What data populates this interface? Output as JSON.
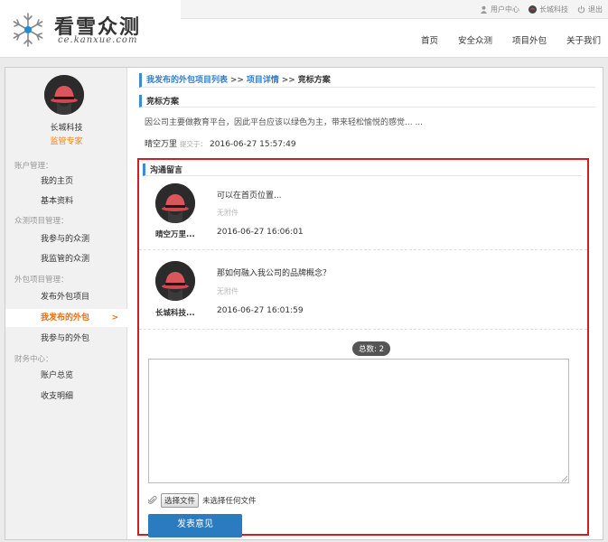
{
  "header": {
    "logo_title": "看雪众测",
    "logo_subtitle": "ce.kanxue.com",
    "top_links": [
      "用户中心",
      "长城科技",
      "退出"
    ],
    "nav": [
      "首页",
      "安全众测",
      "项目外包",
      "关于我们"
    ]
  },
  "sidebar": {
    "username": "长城科技",
    "role": "监管专家",
    "groups": [
      {
        "title": "账户管理：",
        "items": [
          "我的主页",
          "基本资料"
        ]
      },
      {
        "title": "众测项目管理：",
        "items": [
          "我参与的众测",
          "我监管的众测"
        ]
      },
      {
        "title": "外包项目管理：",
        "items": [
          "发布外包项目",
          "我发布的外包",
          "我参与的外包"
        ]
      },
      {
        "title": "财务中心：",
        "items": [
          "账户总览",
          "收支明细"
        ]
      }
    ],
    "active_arrow": ">"
  },
  "breadcrumb": {
    "link1": "我发布的外包项目列表",
    "sep": ">>",
    "link2": "项目详情",
    "current": "竞标方案"
  },
  "bid": {
    "title": "竞标方案",
    "description": "因公司主要做教育平台，因此平台应该以绿色为主，带来轻松愉悦的感觉... ...",
    "author": "晴空万里",
    "submitted_label": "提交于：",
    "submitted_time": "2016-06-27 15:57:49"
  },
  "communication": {
    "title": "沟通留言",
    "messages": [
      {
        "name": "晴空万里...",
        "text": "可以在首页位置...",
        "attachment": "无附件",
        "time": "2016-06-27 16:06:01"
      },
      {
        "name": "长城科技...",
        "text": "那如何融入我公司的品牌概念？",
        "attachment": "无附件",
        "time": "2016-06-27 16:01:59"
      }
    ],
    "total": "总数: 2",
    "file_button": "选择文件",
    "file_status": "未选择任何文件",
    "submit": "发表意见"
  },
  "colors": {
    "accent_blue": "#2f7fcf",
    "accent_orange": "#ef6c0a",
    "highlight_red": "#d01e24",
    "button_blue": "#2a7bbf"
  }
}
